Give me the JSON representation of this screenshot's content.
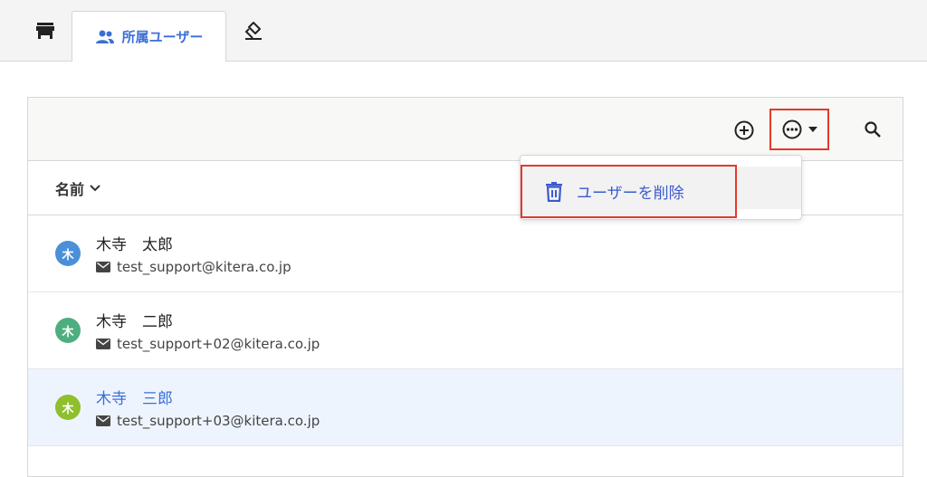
{
  "tabs": {
    "store_icon": "store-icon",
    "users_label": "所属ユーザー",
    "users_icon": "users-icon",
    "stamp_icon": "stamp-icon"
  },
  "toolbar": {
    "add_icon": "plus-circle-icon",
    "more_icon": "more-horizontal-circle-icon",
    "dropdown_icon": "caret-down-icon",
    "search_icon": "search-icon"
  },
  "list": {
    "column_header": "名前",
    "rows": [
      {
        "avatar": "木",
        "avatar_color": "#4a90d9",
        "name": "木寺　太郎",
        "email": "test_support@kitera.co.jp"
      },
      {
        "avatar": "木",
        "avatar_color": "#4fae7f",
        "name": "木寺　二郎",
        "email": "test_support+02@kitera.co.jp"
      },
      {
        "avatar": "木",
        "avatar_color": "#8fbf2b",
        "name": "木寺　三郎",
        "email": "test_support+03@kitera.co.jp",
        "selected": true
      }
    ]
  },
  "menu": {
    "delete_label": "ユーザーを削除",
    "delete_icon": "trash-icon"
  },
  "colors": {
    "accent": "#3b6fd8",
    "highlight_border": "#e53929",
    "selected_row_bg": "#eef4fd"
  }
}
